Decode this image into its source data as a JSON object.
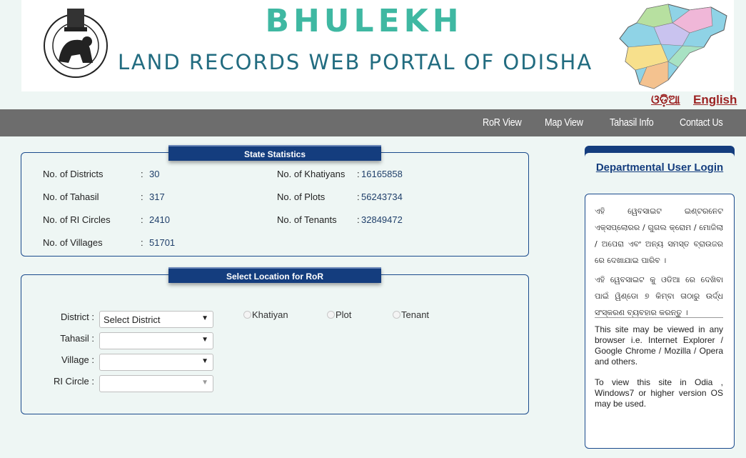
{
  "header": {
    "brand": "BHULEKH",
    "portal_title": "LAND RECORDS WEB PORTAL OF ODISHA"
  },
  "language": {
    "odia": "ଓଡ଼ିଆ",
    "english": "English"
  },
  "nav": {
    "items": [
      "RoR View",
      "Map View",
      "Tahasil Info",
      "Contact Us"
    ]
  },
  "state_statistics": {
    "title": "State Statistics",
    "districts_label": "No. of Districts",
    "districts_value": "30",
    "tahasil_label": "No. of Tahasil",
    "tahasil_value": "317",
    "ri_label": "No. of RI Circles",
    "ri_value": "2410",
    "villages_label": "No. of Villages",
    "villages_value": "51701",
    "khatiyans_label": "No. of Khatiyans",
    "khatiyans_value": "16165858",
    "plots_label": "No. of Plots",
    "plots_value": "56243734",
    "tenants_label": "No. of Tenants",
    "tenants_value": "32849472",
    "sep": ":"
  },
  "select_location": {
    "title": "Select Location for RoR",
    "district_label": "District :",
    "district_value": "Select District",
    "tahasil_label": "Tahasil :",
    "village_label": "Village :",
    "ri_label": "RI Circle :",
    "radio_khatiyan": "Khatiyan",
    "radio_plot": "Plot",
    "radio_tenant": "Tenant"
  },
  "sidebar": {
    "login": "Departmental User Login",
    "odia_p1": "ଏହି ୱେବସାଇଟ ଇଣ୍ଟରନେଟ ଏକ୍ସପ୍ଲୋରର / ଗୁଗଲ କ୍ରୋମ / ମୋଜିଲା / ଅପେରା ଏବଂ ଅନ୍ୟ ସମସ୍ତ ବ୍ରାଉଜର ରେ ଦେଖାଯାଇ ପାରିବ ।",
    "odia_p2": "ଏହି ୱେବସାଇଟ କୁ ଓଡିଆ ରେ ଦେଖିବା ପାଇଁ ୱିଣ୍ଡୋ ୭ କିମ୍ବା ତାଠାରୁ ଉର୍ଦ୍ଧ ସଂସ୍କରଣ ବ୍ୟବହାର କରନ୍ତୁ ।",
    "en_p1": "This site may be viewed in any browser i.e. Internet Explorer / Google Chrome / Mozilla / Opera and others.",
    "en_p2": "To view this site in Odia , Windows7 or higher version OS may be used."
  },
  "colors": {
    "nav_bg": "#6d6d6d",
    "panel_title_bg": "#143d7e",
    "link_red": "#9b2222",
    "brand_teal": "#3fb8a2"
  },
  "icons": {
    "emblem": "odisha-emblem-icon",
    "map": "odisha-map-icon"
  }
}
